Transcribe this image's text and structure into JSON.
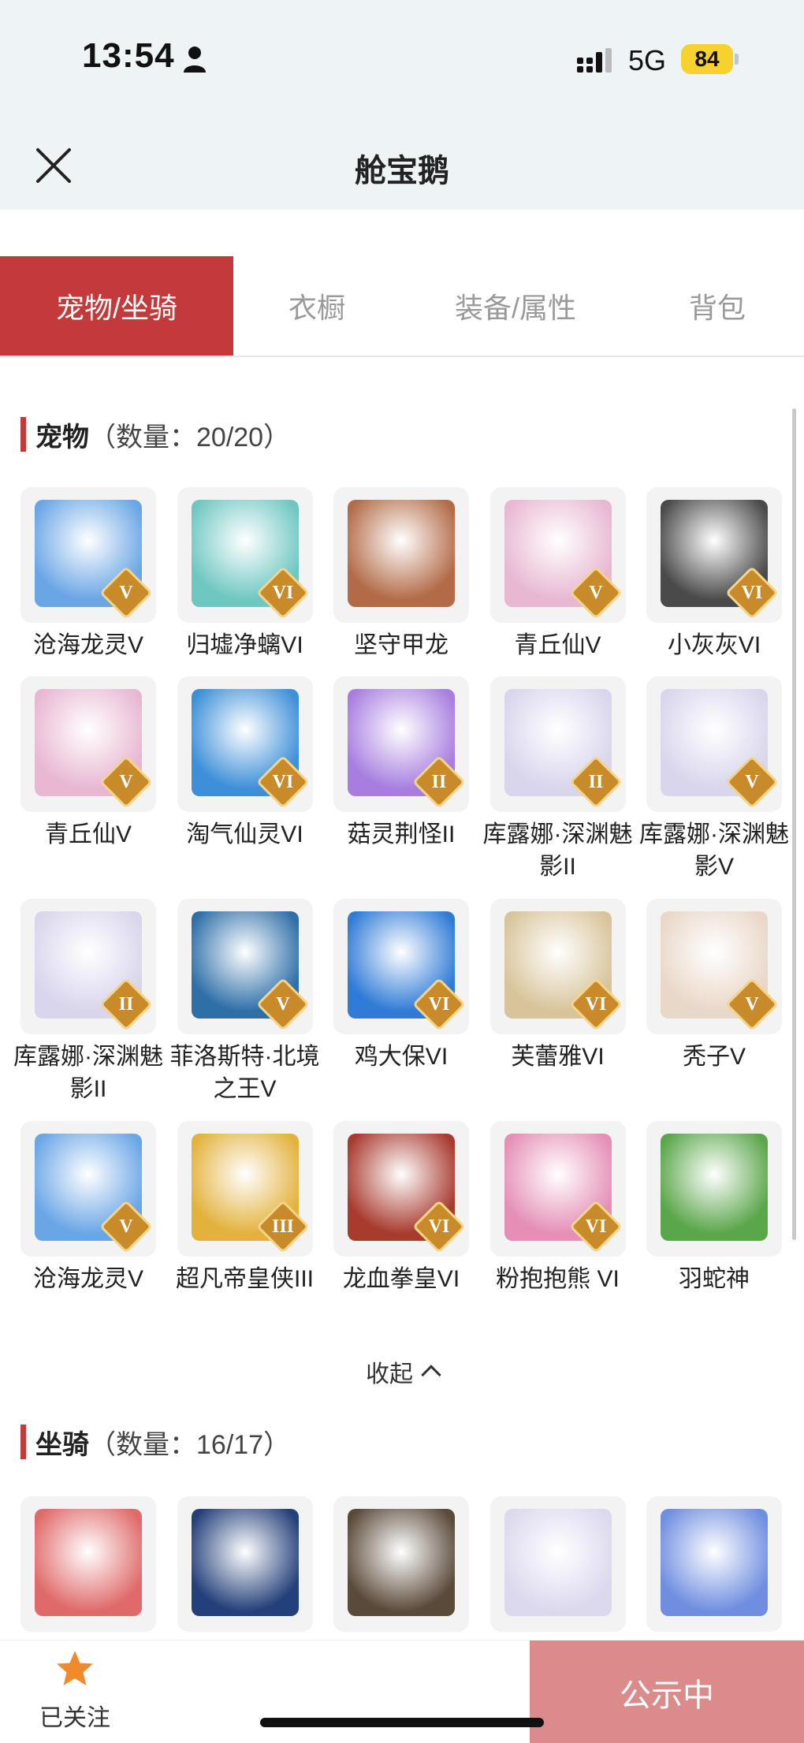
{
  "status": {
    "time": "13:54",
    "network": "5G",
    "battery": "84"
  },
  "nav": {
    "title": "舱宝鹅"
  },
  "tabs": [
    "宠物/坐骑",
    "衣橱",
    "装备/属性",
    "背包"
  ],
  "pets": {
    "title": "宠物",
    "count": "（数量：20/20）",
    "items": [
      {
        "name": "沧海龙灵V",
        "tier": "V",
        "color": "#6aa6e6"
      },
      {
        "name": "归墟净螭VI",
        "tier": "VI",
        "color": "#6fc7c2"
      },
      {
        "name": "坚守甲龙",
        "tier": "",
        "color": "#b36b47"
      },
      {
        "name": "青丘仙V",
        "tier": "V",
        "color": "#e8b7d2"
      },
      {
        "name": "小灰灰VI",
        "tier": "VI",
        "color": "#4a4a4a"
      },
      {
        "name": "青丘仙V",
        "tier": "V",
        "color": "#e8b7d2"
      },
      {
        "name": "淘气仙灵VI",
        "tier": "VI",
        "color": "#3c8fd8"
      },
      {
        "name": "菇灵荆怪II",
        "tier": "II",
        "color": "#a77ee0"
      },
      {
        "name": "库露娜·深渊魅影II",
        "tier": "II",
        "color": "#d9d5ec"
      },
      {
        "name": "库露娜·深渊魅影V",
        "tier": "V",
        "color": "#d9d5ec"
      },
      {
        "name": "库露娜·深渊魅影II",
        "tier": "II",
        "color": "#d9d5ec"
      },
      {
        "name": "菲洛斯特·北境之王V",
        "tier": "V",
        "color": "#2e6fa8"
      },
      {
        "name": "鸡大保VI",
        "tier": "VI",
        "color": "#2f7bd6"
      },
      {
        "name": "芙蕾雅VI",
        "tier": "VI",
        "color": "#d8c49a"
      },
      {
        "name": "秃子V",
        "tier": "V",
        "color": "#e9d7c8"
      },
      {
        "name": "沧海龙灵V",
        "tier": "V",
        "color": "#6aa6e6"
      },
      {
        "name": "超凡帝皇侠III",
        "tier": "III",
        "color": "#e3b23c"
      },
      {
        "name": "龙血拳皇VI",
        "tier": "VI",
        "color": "#a83a2e"
      },
      {
        "name": "粉抱抱熊 VI",
        "tier": "VI",
        "color": "#e58fb6"
      },
      {
        "name": "羽蛇神",
        "tier": "",
        "color": "#5aa64a"
      }
    ]
  },
  "collapse_label": "收起",
  "mounts": {
    "title": "坐骑",
    "count": "（数量：16/17）",
    "colors": [
      "#e06a6a",
      "#24407a",
      "#5a4a3a",
      "#dcd8ee",
      "#6f8ee0"
    ]
  },
  "bottom": {
    "follow_label": "已关注",
    "status_button": "公示中"
  },
  "colors": {
    "accent": "#c43a3a",
    "button": "#dc8b8b",
    "tier_badge": "#c98a2a"
  }
}
